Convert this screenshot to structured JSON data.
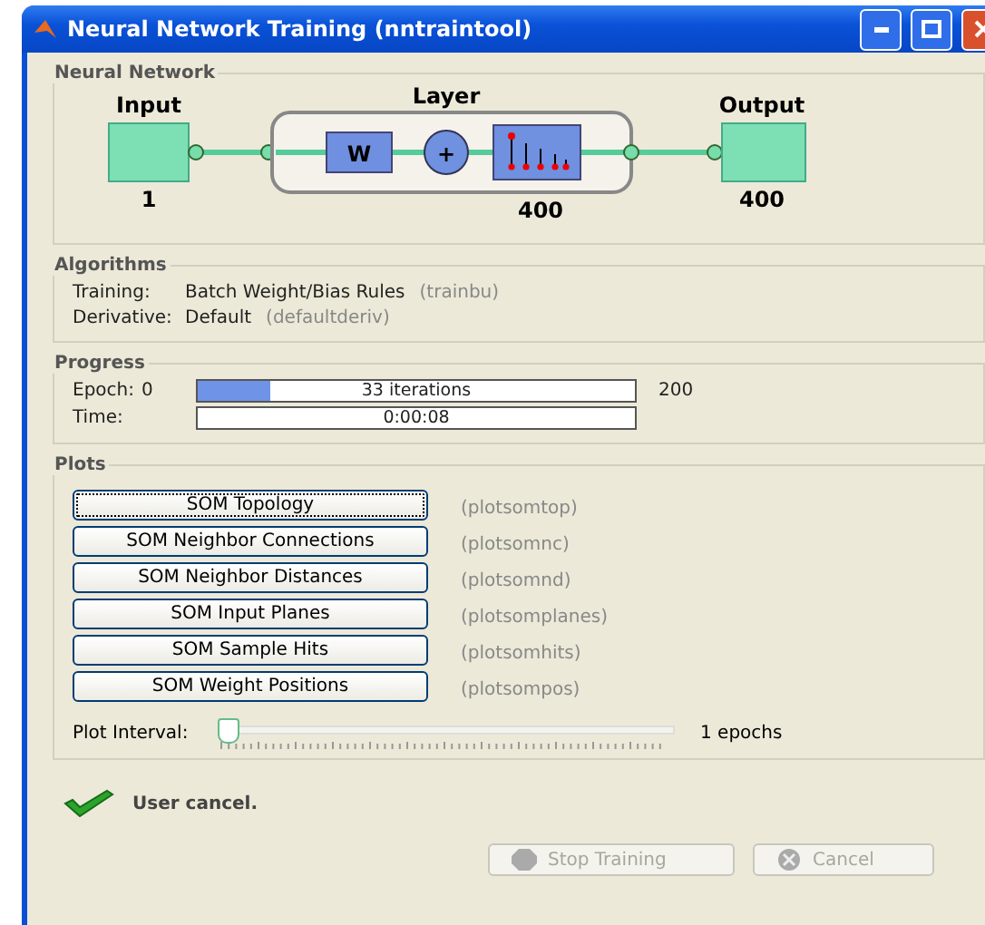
{
  "window": {
    "title": "Neural Network Training (nntraintool)"
  },
  "network": {
    "title": "Neural Network",
    "input_label": "Input",
    "input_size": "1",
    "layer_label": "Layer",
    "weight_symbol": "W",
    "sum_symbol": "+",
    "layer_size": "400",
    "output_label": "Output",
    "output_size": "400"
  },
  "algorithms": {
    "title": "Algorithms",
    "rows": [
      {
        "label": "Training:",
        "value": "Batch Weight/Bias Rules",
        "code": "(trainbu)"
      },
      {
        "label": "Derivative:",
        "value": "Default",
        "code": "(defaultderiv)"
      }
    ]
  },
  "progress": {
    "title": "Progress",
    "rows": [
      {
        "label": "Epoch:",
        "start": "0",
        "text": "33 iterations",
        "level": 0.165,
        "end": "200"
      },
      {
        "label": "Time:",
        "text": "0:00:08"
      }
    ]
  },
  "plots": {
    "title": "Plots",
    "buttons": [
      {
        "label": "SOM Topology",
        "code": "(plotsomtop)",
        "focused": true
      },
      {
        "label": "SOM Neighbor Connections",
        "code": "(plotsomnc)",
        "focused": false
      },
      {
        "label": "SOM Neighbor Distances",
        "code": "(plotsomnd)",
        "focused": false
      },
      {
        "label": "SOM Input Planes",
        "code": "(plotsomplanes)",
        "focused": false
      },
      {
        "label": "SOM Sample Hits",
        "code": "(plotsomhits)",
        "focused": false
      },
      {
        "label": "SOM Weight Positions",
        "code": "(plotsompos)",
        "focused": false
      }
    ],
    "interval_label": "Plot Interval:",
    "interval": {
      "level": 0
    },
    "interval_value": "1 epochs"
  },
  "status": {
    "text": "User cancel."
  },
  "buttons": [
    {
      "label": "Stop Training",
      "kind": "stop",
      "disabled": true
    },
    {
      "label": "Cancel",
      "kind": "cancel",
      "disabled": true
    }
  ]
}
